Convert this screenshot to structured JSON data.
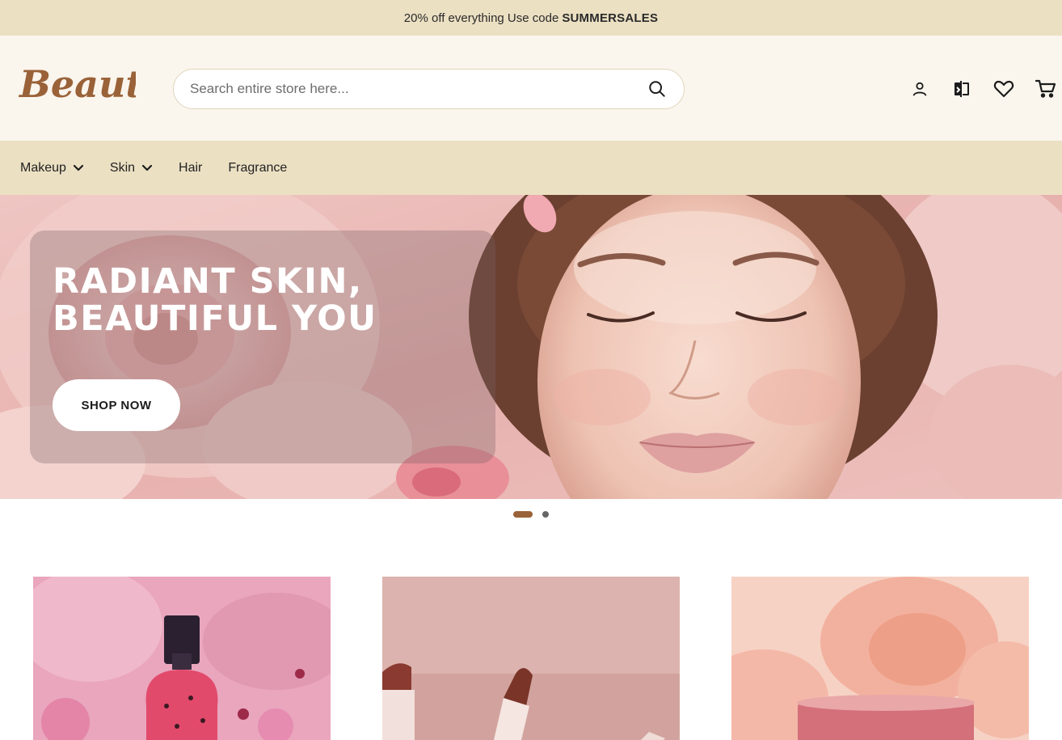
{
  "promo": {
    "text": "20% off everything Use code",
    "code": "SUMMERSALES"
  },
  "header": {
    "logo_text": "Beauty",
    "search_placeholder": "Search entire store here...",
    "icons": [
      "account-icon",
      "compare-icon",
      "wishlist-icon",
      "cart-icon"
    ]
  },
  "nav": {
    "items": [
      {
        "label": "Makeup",
        "has_dropdown": true
      },
      {
        "label": "Skin",
        "has_dropdown": true
      },
      {
        "label": "Hair",
        "has_dropdown": false
      },
      {
        "label": "Fragrance",
        "has_dropdown": false
      }
    ]
  },
  "hero": {
    "title_line1": "RADIANT SKIN,",
    "title_line2": "BEAUTIFUL YOU",
    "cta_label": "SHOP NOW",
    "slides_total": 2,
    "active_slide": 1
  },
  "colors": {
    "promo_bg": "#ece0c3",
    "header_bg": "#faf5ed",
    "brand_brown": "#9a6238",
    "hero_pink": "#e9b9b6"
  }
}
